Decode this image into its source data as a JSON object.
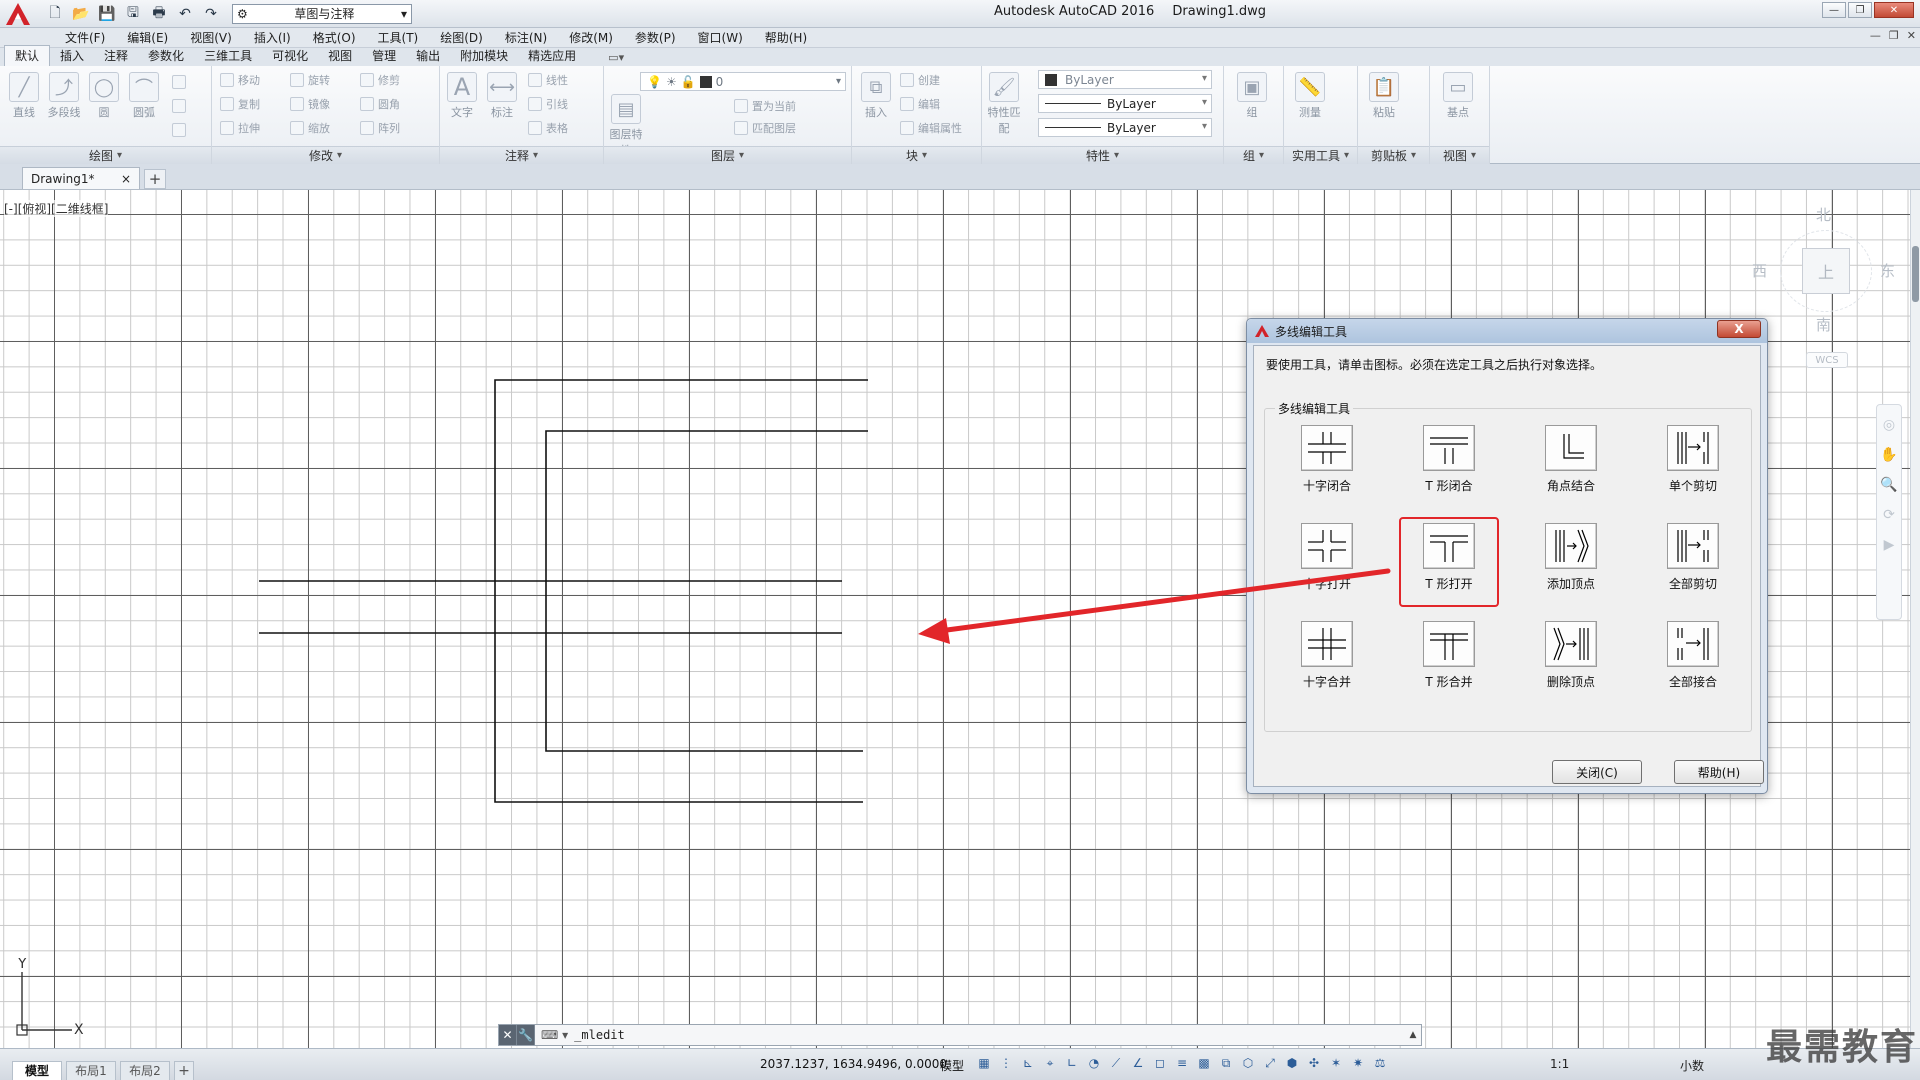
{
  "app": {
    "title": "Autodesk AutoCAD 2016",
    "file": "Drawing1.dwg",
    "workspace": "草图与注释"
  },
  "menu": [
    "文件(F)",
    "编辑(E)",
    "视图(V)",
    "插入(I)",
    "格式(O)",
    "工具(T)",
    "绘图(D)",
    "标注(N)",
    "修改(M)",
    "参数(P)",
    "窗口(W)",
    "帮助(H)"
  ],
  "ribbon_tabs": [
    "默认",
    "插入",
    "注释",
    "参数化",
    "三维工具",
    "可视化",
    "视图",
    "管理",
    "输出",
    "附加模块",
    "精选应用"
  ],
  "ribbon_panels": {
    "draw": {
      "title": "绘图",
      "tools": [
        "直线",
        "多段线",
        "圆",
        "圆弧"
      ]
    },
    "modify": {
      "title": "修改",
      "tools": [
        "移动",
        "旋转",
        "修剪",
        "复制",
        "镜像",
        "圆角",
        "拉伸",
        "缩放",
        "阵列"
      ]
    },
    "annotate": {
      "title": "注释",
      "tools": [
        "文字",
        "标注",
        "线性",
        "引线",
        "表格"
      ]
    },
    "layers": {
      "title": "图层",
      "big": "图层特性",
      "combo": "0",
      "tools": [
        "置为当前",
        "匹配图层"
      ]
    },
    "block": {
      "title": "块",
      "big": "插入",
      "tools": [
        "创建",
        "编辑",
        "编辑属性"
      ]
    },
    "properties": {
      "title": "特性",
      "big": "特性匹配",
      "color": "ByLayer",
      "linetype": "ByLayer",
      "lineweight": "ByLayer"
    },
    "groups": {
      "title": "组",
      "big": "组"
    },
    "utilities": {
      "title": "实用工具",
      "big": "测量"
    },
    "clipboard": {
      "title": "剪贴板",
      "big": "粘贴"
    },
    "view": {
      "title": "视图",
      "big": "基点"
    }
  },
  "doc_tab": {
    "name": "Drawing1*",
    "close": "×",
    "add": "+"
  },
  "viewport_label": "[-][俯视][二维线框]",
  "viewcube": {
    "north": "北",
    "south": "南",
    "east": "东",
    "west": "西",
    "top": "上",
    "wcs": "WCS"
  },
  "ucs": {
    "x": "X",
    "y": "Y"
  },
  "command": {
    "input": "_mledit",
    "prompt": "⌨ ▾"
  },
  "status": {
    "layouts": [
      "模型",
      "布局1",
      "布局2"
    ],
    "add_layout": "+",
    "coords": "2037.1237, 1634.9496, 0.0000",
    "model": "模型",
    "scale": "1:1",
    "units": "小数"
  },
  "watermark": "最需教育",
  "dialog": {
    "title": "多线编辑工具",
    "close": "X",
    "instruction": "要使用工具，请单击图标。必须在选定工具之后执行对象选择。",
    "group_label": "多线编辑工具",
    "tools": [
      "十字闭合",
      "T 形闭合",
      "角点结合",
      "单个剪切",
      "十字打开",
      "T 形打开",
      "添加顶点",
      "全部剪切",
      "十字合并",
      "T 形合并",
      "删除顶点",
      "全部接合"
    ],
    "highlighted_tool": "T 形打开",
    "close_button": "关闭(C)",
    "help_button": "帮助(H)"
  },
  "colors": {
    "accent_red": "#e2262a",
    "grid_major": "#5e5e5e",
    "grid_minor": "#c9c9c9",
    "dialog_bg": "#f0f0f0"
  }
}
